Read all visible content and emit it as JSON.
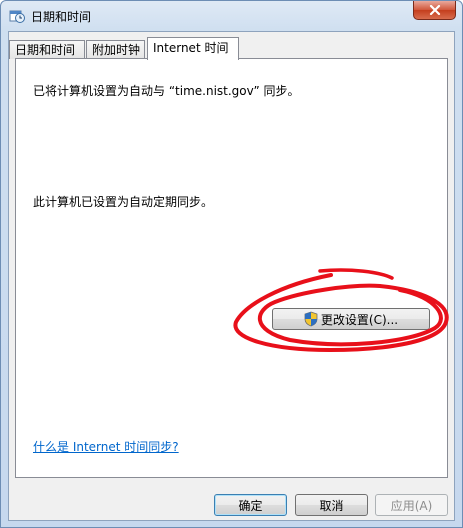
{
  "window": {
    "title": "日期和时间"
  },
  "tabs": [
    {
      "label": "日期和时间",
      "active": false
    },
    {
      "label": "附加时钟",
      "active": false
    },
    {
      "label": "Internet 时间",
      "active": true
    }
  ],
  "panel": {
    "sync_status": "已将计算机设置为自动与 “time.nist.gov” 同步。",
    "schedule_status": "此计算机已设置为自动定期同步。",
    "change_settings_label": "更改设置(C)...",
    "help_link": "什么是 Internet 时间同步?"
  },
  "buttons": {
    "ok": "确定",
    "cancel": "取消",
    "apply": "应用(A)"
  },
  "colors": {
    "link": "#0066cc",
    "annotation": "#e8101a"
  },
  "icons": {
    "title": "clock-calendar-icon",
    "close": "close-icon",
    "change": "uac-shield-icon"
  }
}
